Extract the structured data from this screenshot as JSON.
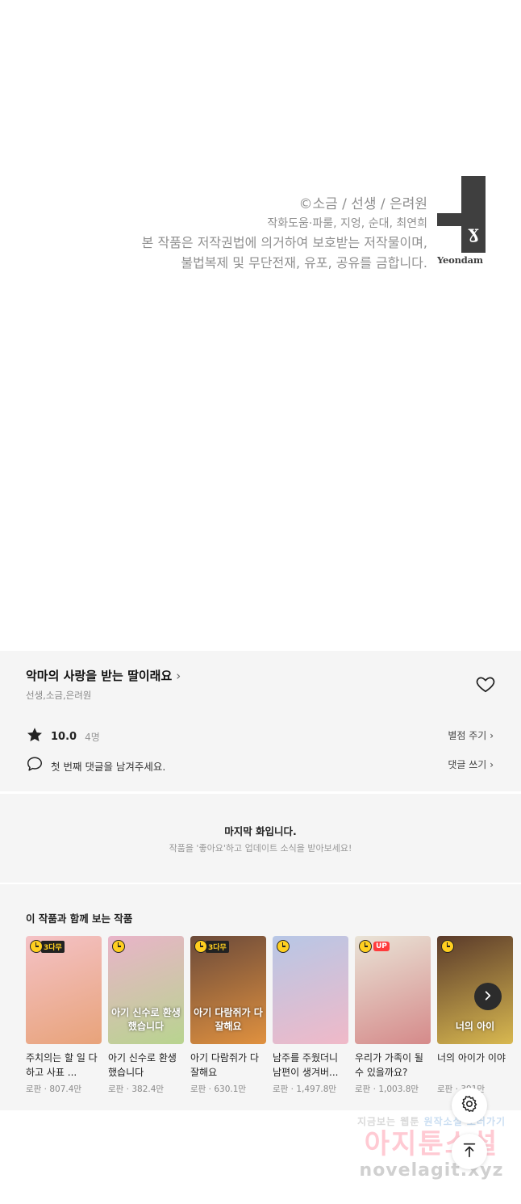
{
  "credits": {
    "line1": "©소금 / 선생 / 은려원",
    "line2": "작화도움·파룰, 지엉, 순대, 최연희",
    "line3": "본 작품은 저작권법에 의거하여 보호받는 저작물이며,",
    "line4": "불법복제 및 무단전재, 유포, 공유를 금합니다.",
    "logo_text": "Yeondam"
  },
  "work": {
    "title": "악마의 사랑을 받는 딸이래요",
    "authors": "선생,소금,은려원",
    "rating": "10.0",
    "rating_count": "4명",
    "rate_link": "별점 주기",
    "comment_prompt": "첫 번째 댓글을 남겨주세요.",
    "comment_link": "댓글 쓰기"
  },
  "last_episode": {
    "heading": "마지막 화입니다.",
    "subtext": "작품을 '좋아요'하고 업데이트 소식을 받아보세요!"
  },
  "recommendations": {
    "title": "이 작품과 함께 보는 작품",
    "items": [
      {
        "name": "주치의는 할 일 다 하고 사표 ...",
        "meta": "로판 · 807.4만",
        "badge": "3다무",
        "up": "",
        "cover_title": "",
        "colors": [
          "#f4c2c6",
          "#e8a37a"
        ]
      },
      {
        "name": "아기 신수로 환생했습니다",
        "meta": "로판 · 382.4만",
        "badge": "",
        "up": "",
        "cover_title": "아기 신수로 환생했습니다",
        "colors": [
          "#e9b4c9",
          "#b8d48f"
        ]
      },
      {
        "name": "아기 다람쥐가 다 잘해요",
        "meta": "로판 · 630.1만",
        "badge": "3다무",
        "up": "",
        "cover_title": "아기 다람쥐가 다 잘해요",
        "colors": [
          "#6b4a3a",
          "#e0913f"
        ]
      },
      {
        "name": "남주를 주웠더니 남편이 생겨버...",
        "meta": "로판 · 1,497.8만",
        "badge": "",
        "up": "",
        "cover_title": "",
        "colors": [
          "#b7c7e6",
          "#f0b9c8"
        ]
      },
      {
        "name": "우리가 가족이 될 수 있을까요?",
        "meta": "로판 · 1,003.8만",
        "badge": "",
        "up": "UP",
        "cover_title": "",
        "colors": [
          "#e9e3d6",
          "#d58a8a"
        ]
      },
      {
        "name": "너의 아이가 이야",
        "meta": "로판 · 391만",
        "badge": "",
        "up": "",
        "cover_title": "너의 아이",
        "colors": [
          "#5a3a2a",
          "#d8b850"
        ]
      }
    ]
  },
  "watermark": {
    "line1_a": "지금보는 웹툰",
    "line1_b": "원작소설 보러가기",
    "line2": "아지툰소설",
    "line3": "novelagit.xyz"
  }
}
